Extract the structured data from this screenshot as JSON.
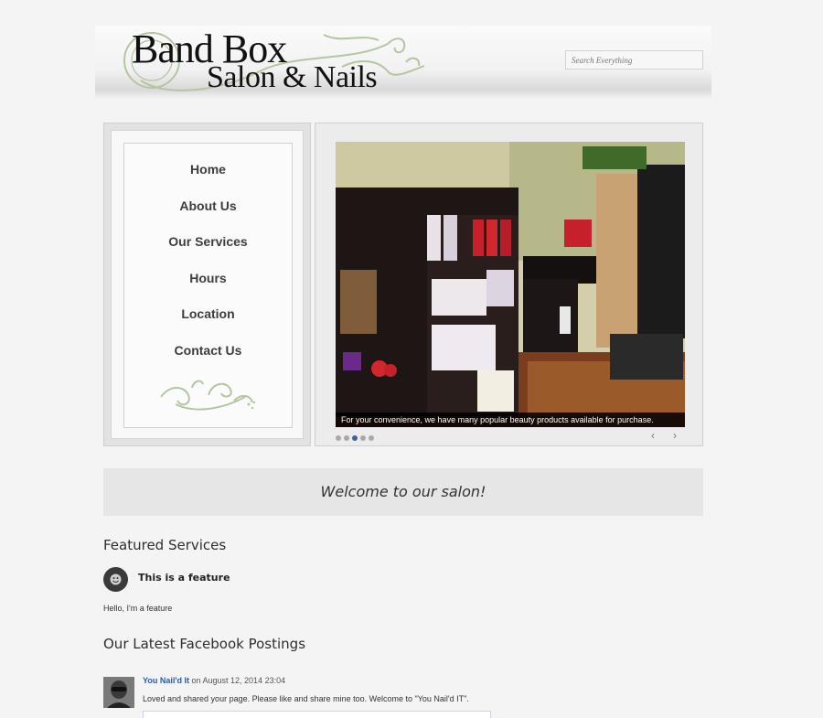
{
  "header": {
    "logo_line1": "Band Box",
    "logo_line2": "Salon & Nails",
    "search_placeholder": "Search Everything"
  },
  "nav": {
    "items": [
      "Home",
      "About Us",
      "Our Services",
      "Hours",
      "Location",
      "Contact Us"
    ]
  },
  "slider": {
    "caption": "For your convenience, we have many popular beauty products available for purchase.",
    "dot_count": 5,
    "active_dot": 2,
    "prev_glyph": "‹",
    "next_glyph": "›"
  },
  "welcome": "Welcome to our salon!",
  "features": {
    "heading": "Featured Services",
    "title": "This is a feature",
    "text": "Hello, I'm a feature"
  },
  "facebook": {
    "heading": "Our Latest Facebook Postings",
    "author": "You Nail'd It",
    "date": "on August 12, 2014 23:04",
    "text": "Loved and shared your page. Please like and share mine too. Welcome to \"You Nail'd IT\"."
  },
  "colors": {
    "background": "#f4f4f4",
    "nav_text": "#3d3d3d",
    "link": "#2b5aa5",
    "active_dot": "#3a62a6",
    "flourish": "#b4c6a0"
  }
}
